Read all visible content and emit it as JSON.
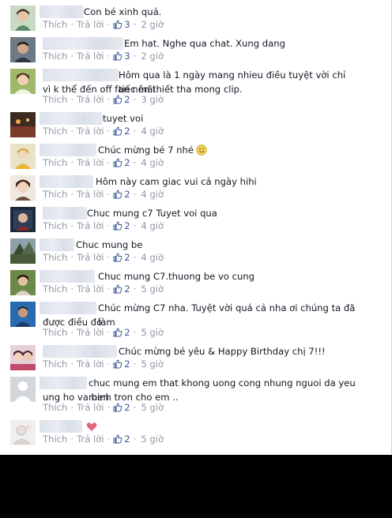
{
  "actions": {
    "like_label": "Thích",
    "reply_label": "Trả lời",
    "separator": "·"
  },
  "comments": [
    {
      "text": "Con bé xinh quá.",
      "likes": "3",
      "time": "2 giờ"
    },
    {
      "text": "Em hat. Nghe qua chat. Xung dang",
      "likes": "3",
      "time": "2 giờ"
    },
    {
      "text_line1": "Hôm qua là 1 ngày mang nhieu điều tuyệt vời chỉ tiếc mãi",
      "text_line2": "vì k thể đến off fan nên thiết tha mong clip.",
      "likes": "2",
      "time": "3 giờ"
    },
    {
      "text": "tuyet voi",
      "likes": "2",
      "time": "4 giờ"
    },
    {
      "text": "Chúc mừng bé 7 nhé",
      "emoji": "smile-emoji",
      "likes": "2",
      "time": "4 giờ"
    },
    {
      "text": "Hôm này cam giac vui cả ngày hihi",
      "likes": "2",
      "time": "4 giờ"
    },
    {
      "text": "Chuc mung c7 Tuyet voi qua",
      "likes": "2",
      "time": "4 giờ"
    },
    {
      "text": "Chuc mung be",
      "likes": "2",
      "time": "4 giờ"
    },
    {
      "text": "Chuc mung C7.thuong be vo cung",
      "likes": "2",
      "time": "5 giờ"
    },
    {
      "text_line1": "Chúc mừng C7 nha. Tuyệt vời quá cả nha ơi chúng ta đã làm",
      "text_line2": "được điều đó",
      "likes": "2",
      "time": "5 giờ"
    },
    {
      "text": "Chúc mừng bé yêu & Happy Birthday chị 7!!!",
      "likes": "2",
      "time": "5 giờ"
    },
    {
      "text_line1": "chuc mung em that khong uong cong nhung nguoi da yeu men",
      "text_line2": "ung ho va binh tron cho em ..",
      "likes": "2",
      "time": "5 giờ"
    },
    {
      "text": "",
      "emoji": "heart-emoji",
      "likes": "2",
      "time": "5 giờ"
    }
  ],
  "colors": {
    "link": "#3b5998",
    "meta": "#9197a3",
    "text": "#141823"
  }
}
